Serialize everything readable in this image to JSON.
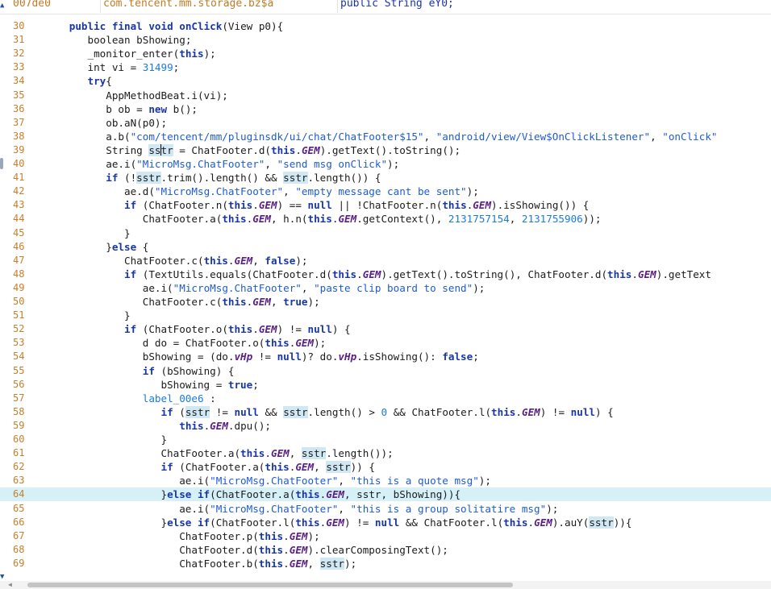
{
  "tabs": [
    "007de0",
    "com.tencent.mm.storage.bz$a",
    "public String eY0;"
  ],
  "lines": [
    {
      "n": "30",
      "s": [
        [
          "   ",
          ""
        ],
        [
          "public final void",
          "k"
        ],
        [
          " ",
          ""
        ],
        [
          "onClick",
          "k"
        ],
        [
          "(View p0){",
          ""
        ]
      ]
    },
    {
      "n": "31",
      "s": [
        [
          "      ",
          ""
        ],
        [
          "boolean bShowing;",
          ""
        ]
      ]
    },
    {
      "n": "32",
      "s": [
        [
          "      _monitor_enter(",
          ""
        ],
        [
          "this",
          "k"
        ],
        [
          ");",
          ""
        ]
      ]
    },
    {
      "n": "33",
      "s": [
        [
          "      int vi = ",
          ""
        ],
        [
          "31499",
          "n"
        ],
        [
          ";",
          ""
        ]
      ]
    },
    {
      "n": "34",
      "s": [
        [
          "      ",
          ""
        ],
        [
          "try",
          "k"
        ],
        [
          "{",
          ""
        ]
      ]
    },
    {
      "n": "35",
      "s": [
        [
          "         AppMethodBeat.i(vi);",
          ""
        ]
      ]
    },
    {
      "n": "36",
      "s": [
        [
          "         b ob = ",
          ""
        ],
        [
          "new",
          "k"
        ],
        [
          " b();",
          ""
        ]
      ]
    },
    {
      "n": "37",
      "s": [
        [
          "         ob.aN(p0);",
          ""
        ]
      ]
    },
    {
      "n": "38",
      "s": [
        [
          "         a.b(",
          ""
        ],
        [
          "\"com/tencent/mm/pluginsdk/ui/chat/ChatFooter$15\"",
          "s"
        ],
        [
          ", ",
          ""
        ],
        [
          "\"android/view/View$OnClickListener\"",
          "s"
        ],
        [
          ", ",
          ""
        ],
        [
          "\"onClick\"",
          "s"
        ]
      ]
    },
    {
      "n": "39",
      "s": [
        [
          "         String ",
          ""
        ],
        [
          "ss",
          "h"
        ],
        [
          "CURSOR",
          ""
        ],
        [
          "tr",
          "h"
        ],
        [
          " = ChatFooter.d(",
          ""
        ],
        [
          "this",
          "k"
        ],
        [
          ".",
          ""
        ],
        [
          "GEM",
          "i"
        ],
        [
          ").getText().toString();",
          ""
        ]
      ]
    },
    {
      "n": "40",
      "s": [
        [
          "         ae.i(",
          ""
        ],
        [
          "\"MicroMsg.ChatFooter\"",
          "s"
        ],
        [
          ", ",
          ""
        ],
        [
          "\"send msg onClick\"",
          "s"
        ],
        [
          ");",
          ""
        ]
      ]
    },
    {
      "n": "41",
      "s": [
        [
          "         ",
          ""
        ],
        [
          "if",
          "k"
        ],
        [
          " (!",
          ""
        ],
        [
          "sstr",
          "h"
        ],
        [
          ".trim().length() && ",
          ""
        ],
        [
          "sstr",
          "h"
        ],
        [
          ".length()) {",
          ""
        ]
      ]
    },
    {
      "n": "42",
      "s": [
        [
          "            ae.d(",
          ""
        ],
        [
          "\"MicroMsg.ChatFooter\"",
          "s"
        ],
        [
          ", ",
          ""
        ],
        [
          "\"empty message cant be sent\"",
          "s"
        ],
        [
          ");",
          ""
        ]
      ]
    },
    {
      "n": "43",
      "s": [
        [
          "            ",
          ""
        ],
        [
          "if",
          "k"
        ],
        [
          " (ChatFooter.n(",
          ""
        ],
        [
          "this",
          "k"
        ],
        [
          ".",
          ""
        ],
        [
          "GEM",
          "i"
        ],
        [
          ") == ",
          ""
        ],
        [
          "null",
          "k"
        ],
        [
          " || !ChatFooter.n(",
          ""
        ],
        [
          "this",
          "k"
        ],
        [
          ".",
          ""
        ],
        [
          "GEM",
          "i"
        ],
        [
          ").isShowing()) {",
          ""
        ]
      ]
    },
    {
      "n": "44",
      "s": [
        [
          "               ChatFooter.a(",
          ""
        ],
        [
          "this",
          "k"
        ],
        [
          ".",
          ""
        ],
        [
          "GEM",
          "i"
        ],
        [
          ", h.n(",
          ""
        ],
        [
          "this",
          "k"
        ],
        [
          ".",
          ""
        ],
        [
          "GEM",
          "i"
        ],
        [
          ".getContext(), ",
          ""
        ],
        [
          "2131757154",
          "n"
        ],
        [
          ", ",
          ""
        ],
        [
          "2131755906",
          "n"
        ],
        [
          "));",
          ""
        ]
      ]
    },
    {
      "n": "45",
      "s": [
        [
          "            }",
          ""
        ]
      ]
    },
    {
      "n": "46",
      "s": [
        [
          "         }",
          ""
        ],
        [
          "else",
          "k"
        ],
        [
          " {",
          ""
        ]
      ]
    },
    {
      "n": "47",
      "s": [
        [
          "            ChatFooter.c(",
          ""
        ],
        [
          "this",
          "k"
        ],
        [
          ".",
          ""
        ],
        [
          "GEM",
          "i"
        ],
        [
          ", ",
          ""
        ],
        [
          "false",
          "k"
        ],
        [
          ");",
          ""
        ]
      ]
    },
    {
      "n": "48",
      "s": [
        [
          "            ",
          ""
        ],
        [
          "if",
          "k"
        ],
        [
          " (TextUtils.equals(ChatFooter.d(",
          ""
        ],
        [
          "this",
          "k"
        ],
        [
          ".",
          ""
        ],
        [
          "GEM",
          "i"
        ],
        [
          ").getText().toString(), ChatFooter.d(",
          ""
        ],
        [
          "this",
          "k"
        ],
        [
          ".",
          ""
        ],
        [
          "GEM",
          "i"
        ],
        [
          ").getText",
          ""
        ]
      ]
    },
    {
      "n": "49",
      "s": [
        [
          "               ae.i(",
          ""
        ],
        [
          "\"MicroMsg.ChatFooter\"",
          "s"
        ],
        [
          ", ",
          ""
        ],
        [
          "\"paste clip board to send\"",
          "s"
        ],
        [
          ");",
          ""
        ]
      ]
    },
    {
      "n": "50",
      "s": [
        [
          "               ChatFooter.c(",
          ""
        ],
        [
          "this",
          "k"
        ],
        [
          ".",
          ""
        ],
        [
          "GEM",
          "i"
        ],
        [
          ", ",
          ""
        ],
        [
          "true",
          "k"
        ],
        [
          ");",
          ""
        ]
      ]
    },
    {
      "n": "51",
      "s": [
        [
          "            }",
          ""
        ]
      ]
    },
    {
      "n": "52",
      "s": [
        [
          "            ",
          ""
        ],
        [
          "if",
          "k"
        ],
        [
          " (ChatFooter.o(",
          ""
        ],
        [
          "this",
          "k"
        ],
        [
          ".",
          ""
        ],
        [
          "GEM",
          "i"
        ],
        [
          ") != ",
          ""
        ],
        [
          "null",
          "k"
        ],
        [
          ") {",
          ""
        ]
      ]
    },
    {
      "n": "53",
      "s": [
        [
          "               d do = ChatFooter.o(",
          ""
        ],
        [
          "this",
          "k"
        ],
        [
          ".",
          ""
        ],
        [
          "GEM",
          "i"
        ],
        [
          ");",
          ""
        ]
      ]
    },
    {
      "n": "54",
      "s": [
        [
          "               bShowing = (do.",
          ""
        ],
        [
          "vHp",
          "i"
        ],
        [
          " != ",
          ""
        ],
        [
          "null",
          "k"
        ],
        [
          ")? do.",
          ""
        ],
        [
          "vHp",
          "i"
        ],
        [
          ".isShowing(): ",
          ""
        ],
        [
          "false",
          "k"
        ],
        [
          ";",
          ""
        ]
      ]
    },
    {
      "n": "55",
      "s": [
        [
          "               ",
          ""
        ],
        [
          "if",
          "k"
        ],
        [
          " (bShowing) {",
          ""
        ]
      ]
    },
    {
      "n": "56",
      "s": [
        [
          "                  bShowing = ",
          ""
        ],
        [
          "true",
          "k"
        ],
        [
          ";",
          ""
        ]
      ]
    },
    {
      "n": "57",
      "s": [
        [
          "               ",
          ""
        ],
        [
          "label_00e6",
          "n"
        ],
        [
          " :",
          ""
        ]
      ]
    },
    {
      "n": "58",
      "s": [
        [
          "                  ",
          ""
        ],
        [
          "if",
          "k"
        ],
        [
          " (",
          ""
        ],
        [
          "sstr",
          "h"
        ],
        [
          " != ",
          ""
        ],
        [
          "null",
          "k"
        ],
        [
          " && ",
          ""
        ],
        [
          "sstr",
          "h"
        ],
        [
          ".length() > ",
          ""
        ],
        [
          "0",
          "n"
        ],
        [
          " && ChatFooter.l(",
          ""
        ],
        [
          "this",
          "k"
        ],
        [
          ".",
          ""
        ],
        [
          "GEM",
          "i"
        ],
        [
          ") != ",
          ""
        ],
        [
          "null",
          "k"
        ],
        [
          ") {",
          ""
        ]
      ]
    },
    {
      "n": "59",
      "s": [
        [
          "                     ",
          ""
        ],
        [
          "this",
          "k"
        ],
        [
          ".",
          ""
        ],
        [
          "GEM",
          "i"
        ],
        [
          ".dpu();",
          ""
        ]
      ]
    },
    {
      "n": "60",
      "s": [
        [
          "                  }",
          ""
        ]
      ]
    },
    {
      "n": "61",
      "s": [
        [
          "                  ChatFooter.a(",
          ""
        ],
        [
          "this",
          "k"
        ],
        [
          ".",
          ""
        ],
        [
          "GEM",
          "i"
        ],
        [
          ", ",
          ""
        ],
        [
          "sstr",
          "h"
        ],
        [
          ".length());",
          ""
        ]
      ]
    },
    {
      "n": "62",
      "s": [
        [
          "                  ",
          ""
        ],
        [
          "if",
          "k"
        ],
        [
          " (ChatFooter.a(",
          ""
        ],
        [
          "this",
          "k"
        ],
        [
          ".",
          ""
        ],
        [
          "GEM",
          "i"
        ],
        [
          ", ",
          ""
        ],
        [
          "sstr",
          "h"
        ],
        [
          ")) {",
          ""
        ]
      ]
    },
    {
      "n": "63",
      "s": [
        [
          "                     ae.i(",
          ""
        ],
        [
          "\"MicroMsg.ChatFooter\"",
          "s"
        ],
        [
          ", ",
          ""
        ],
        [
          "\"this is a quote msg\"",
          "s"
        ],
        [
          ");",
          ""
        ]
      ]
    },
    {
      "n": "64",
      "hl": true,
      "s": [
        [
          "                  }",
          ""
        ],
        [
          "else if",
          "k"
        ],
        [
          "(ChatFooter.a(",
          ""
        ],
        [
          "this",
          "k"
        ],
        [
          ".",
          ""
        ],
        [
          "GEM",
          "i"
        ],
        [
          ", sstr, bShowing)){",
          ""
        ]
      ]
    },
    {
      "n": "65",
      "s": [
        [
          "                     ae.i(",
          ""
        ],
        [
          "\"MicroMsg.ChatFooter\"",
          "s"
        ],
        [
          ", ",
          ""
        ],
        [
          "\"this is a group solitatire msg\"",
          "s"
        ],
        [
          ");",
          ""
        ]
      ]
    },
    {
      "n": "66",
      "s": [
        [
          "                  }",
          ""
        ],
        [
          "else if",
          "k"
        ],
        [
          "(ChatFooter.l(",
          ""
        ],
        [
          "this",
          "k"
        ],
        [
          ".",
          ""
        ],
        [
          "GEM",
          "i"
        ],
        [
          ") != ",
          ""
        ],
        [
          "null",
          "k"
        ],
        [
          " && ChatFooter.l(",
          ""
        ],
        [
          "this",
          "k"
        ],
        [
          ".",
          ""
        ],
        [
          "GEM",
          "i"
        ],
        [
          ").auY(",
          ""
        ],
        [
          "sstr",
          "h"
        ],
        [
          ")){",
          ""
        ]
      ]
    },
    {
      "n": "67",
      "s": [
        [
          "                     ChatFooter.p(",
          ""
        ],
        [
          "this",
          "k"
        ],
        [
          ".",
          ""
        ],
        [
          "GEM",
          "i"
        ],
        [
          ");",
          ""
        ]
      ]
    },
    {
      "n": "68",
      "s": [
        [
          "                     ChatFooter.d(",
          ""
        ],
        [
          "this",
          "k"
        ],
        [
          ".",
          ""
        ],
        [
          "GEM",
          "i"
        ],
        [
          ").clearComposingText();",
          ""
        ]
      ]
    },
    {
      "n": "69",
      "s": [
        [
          "                     ChatFooter.b(",
          ""
        ],
        [
          "this",
          "k"
        ],
        [
          ".",
          ""
        ],
        [
          "GEM",
          "i"
        ],
        [
          ", ",
          ""
        ],
        [
          "sstr",
          "h"
        ],
        [
          ");",
          ""
        ]
      ]
    }
  ]
}
